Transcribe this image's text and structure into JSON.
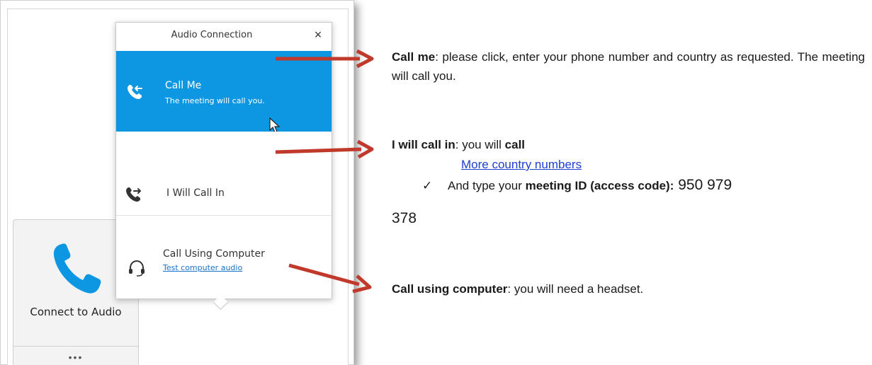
{
  "screenshot": {
    "tile": {
      "label": "Connect to Audio",
      "more": "•••"
    },
    "popup": {
      "title": "Audio Connection",
      "close": "×",
      "options": [
        {
          "title": "Call Me",
          "subtitle": "The meeting will call you."
        },
        {
          "title": "I Will Call In"
        },
        {
          "title": "Call Using Computer",
          "link": "Test computer audio"
        }
      ]
    }
  },
  "notes": {
    "call_me": {
      "bold": "Call me",
      "text": ": please click, enter your phone number and country as requested. The meeting will call you."
    },
    "call_in": {
      "bold1": "I will call in",
      "text1": ": you will ",
      "bold2": "call",
      "link": "More country numbers",
      "check_prefix": "And type your ",
      "check_bold": "meeting ID (access code):",
      "code_part1": " 950 979",
      "code_part2": "378"
    },
    "computer": {
      "bold": "Call using computer",
      "text": ": you will need a headset."
    }
  },
  "colors": {
    "accent": "#0d97e2",
    "arrow": "#c0392b",
    "link": "#1f3fd0"
  },
  "icons": [
    "phone-icon",
    "close-icon",
    "call-me-icon",
    "call-in-icon",
    "headset-icon",
    "cursor-icon",
    "check-icon"
  ]
}
